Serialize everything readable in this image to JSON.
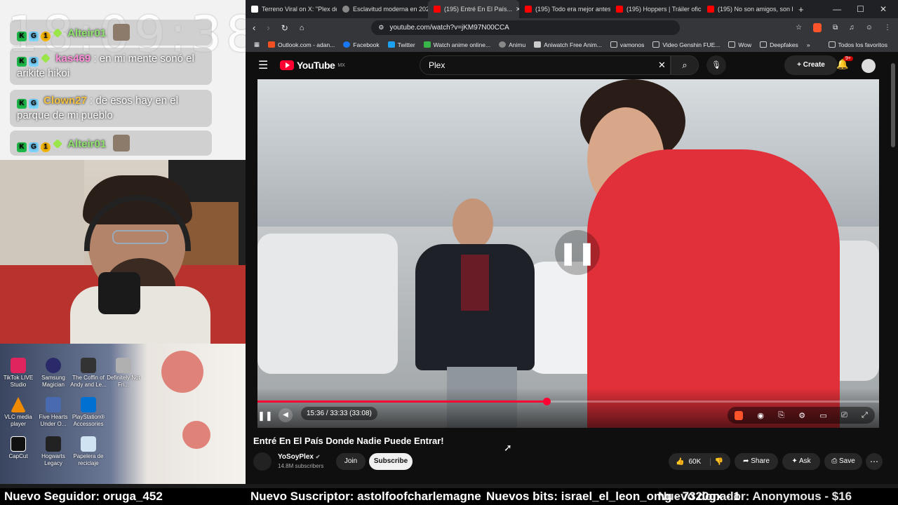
{
  "overlay": {
    "clock": "18:09:38",
    "chat": [
      {
        "user": "Alteir01",
        "text": ""
      },
      {
        "user": "kas469",
        "text": ": en mi mente sonó el arikite hikoi"
      },
      {
        "user": "Clown27",
        "text": ": de esos hay en el parque de mi pueblo"
      },
      {
        "user": "Alteir01",
        "text": ""
      }
    ]
  },
  "desktop": {
    "icons": [
      {
        "label": "TikTok LIVE Studio",
        "color": "#e0245e"
      },
      {
        "label": "Samsung Magician",
        "color": "#2a2a6a"
      },
      {
        "label": "The Coffin of Andy and Le...",
        "color": "#333"
      },
      {
        "label": "Definitely Not Fri...",
        "color": "#b0b0b0"
      },
      {
        "label": "VLC media player",
        "color": "#f08a00"
      },
      {
        "label": "Five Hearts Under O...",
        "color": "#4a6ab0"
      },
      {
        "label": "PlayStation® Accessories",
        "color": "#0070d1"
      },
      {
        "label": "CapCut",
        "color": "#111"
      },
      {
        "label": "Hogwarts Legacy",
        "color": "#222"
      },
      {
        "label": "Papelera de reciclaje",
        "color": "#cfe3f2"
      }
    ]
  },
  "ticker": {
    "follower": "Nuevo Seguidor: oruga_452",
    "subscriber": "Nuevo Suscriptor: astolfoofcharlemagne",
    "bits": "Nuevos bits: israel_el_leon_omg - 7320gx - 1",
    "donor": "Nuevo donador: Anonymous - $16"
  },
  "browser": {
    "tabs": [
      {
        "label": "Terreno Viral on X: \"Plex de...",
        "color": "#000"
      },
      {
        "label": "Esclavitud moderna en 2026...",
        "color": "#888"
      },
      {
        "label": "(195) Entré En El País...",
        "color": "#ff0000",
        "active": true
      },
      {
        "label": "(195) Todo era mejor antes...",
        "color": "#ff0000"
      },
      {
        "label": "(195) Hoppers | Tráiler oficial...",
        "color": "#ff0000"
      },
      {
        "label": "(195) No son amigos, son h...",
        "color": "#ff0000"
      }
    ],
    "new_tab": "+",
    "url": "youtube.com/watch?v=jKM97N00CCA",
    "bookmarks": [
      {
        "label": "Outlook.com - adan...",
        "color": "#f25022"
      },
      {
        "label": "Facebook",
        "color": "#1877f2"
      },
      {
        "label": "Twitter",
        "color": "#1da1f2"
      },
      {
        "label": "Watch anime online...",
        "color": "#3ab54a"
      },
      {
        "label": "Animu",
        "color": "#888"
      },
      {
        "label": "Aniwatch Free Anim...",
        "color": "#ccc"
      },
      {
        "label": "vamonos",
        "color": "#aaa"
      },
      {
        "label": "Video Genshin FUE...",
        "color": "#aaa"
      },
      {
        "label": "Wow",
        "color": "#aaa"
      },
      {
        "label": "Deepfakes",
        "color": "#aaa"
      }
    ],
    "bookmarks_more": "»",
    "all_favorites": "Todos los favoritos"
  },
  "youtube": {
    "logo": "YouTube",
    "region": "MX",
    "search_value": "Plex",
    "create_label": "Create",
    "notif_count": "9+",
    "time_display": "15:36 / 33:33 (33:08)",
    "progress": 0.465,
    "video_title": "Entré En El País Donde Nadie Puede Entrar!",
    "channel": "YoSoyPlex",
    "subscribers": "14.8M subscribers",
    "join_label": "Join",
    "subscribe_label": "Subscribe",
    "likes": "60K",
    "share_label": "Share",
    "ask_label": "Ask",
    "save_label": "Save",
    "colors": {
      "accent": "#ff0033",
      "bg": "#0f0f0f"
    }
  }
}
